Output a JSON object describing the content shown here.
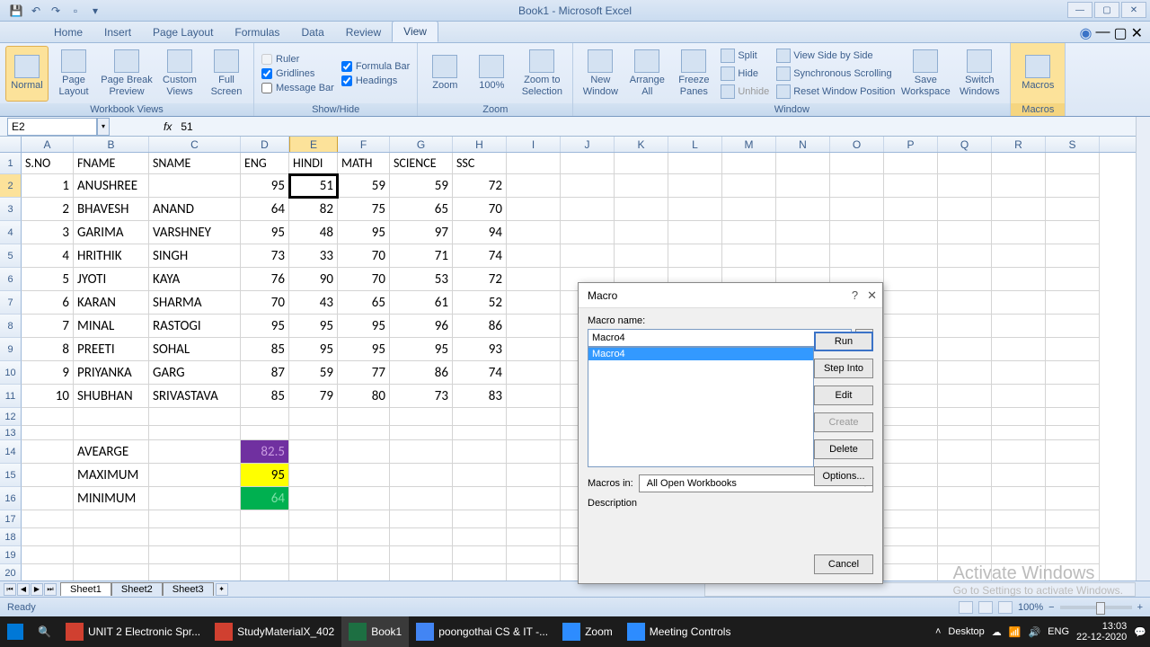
{
  "app": {
    "title": "Book1 - Microsoft Excel",
    "status": "Ready"
  },
  "tabs": {
    "home": "Home",
    "insert": "Insert",
    "page_layout": "Page Layout",
    "formulas": "Formulas",
    "data": "Data",
    "review": "Review",
    "view": "View"
  },
  "ribbon": {
    "workbook_views": {
      "label": "Workbook Views",
      "normal": "Normal",
      "page_layout": "Page Layout",
      "page_break": "Page Break Preview",
      "custom": "Custom Views",
      "full": "Full Screen"
    },
    "show_hide": {
      "label": "Show/Hide",
      "ruler": "Ruler",
      "gridlines": "Gridlines",
      "message_bar": "Message Bar",
      "formula_bar": "Formula Bar",
      "headings": "Headings"
    },
    "zoom": {
      "label": "Zoom",
      "zoom": "Zoom",
      "hundred": "100%",
      "selection": "Zoom to Selection"
    },
    "window": {
      "label": "Window",
      "new": "New Window",
      "arrange": "Arrange All",
      "freeze": "Freeze Panes",
      "split": "Split",
      "hide": "Hide",
      "unhide": "Unhide",
      "side": "View Side by Side",
      "sync": "Synchronous Scrolling",
      "reset": "Reset Window Position",
      "save": "Save Workspace",
      "switch": "Switch Windows"
    },
    "macros": {
      "label": "Macros",
      "macros": "Macros"
    }
  },
  "name_box": "E2",
  "formula_value": "51",
  "columns": [
    "A",
    "B",
    "C",
    "D",
    "E",
    "F",
    "G",
    "H",
    "I",
    "J",
    "K",
    "L",
    "M",
    "N",
    "O",
    "P",
    "Q",
    "R",
    "S"
  ],
  "headers": [
    "S.NO",
    "FNAME",
    "SNAME",
    "ENG",
    "HINDI",
    "MATH",
    "SCIENCE",
    "SSC"
  ],
  "rows": [
    {
      "sno": "1",
      "fname": "ANUSHREE",
      "sname": "",
      "eng": "95",
      "hindi": "51",
      "math": "59",
      "science": "59",
      "ssc": "72"
    },
    {
      "sno": "2",
      "fname": "BHAVESH",
      "sname": "ANAND",
      "eng": "64",
      "hindi": "82",
      "math": "75",
      "science": "65",
      "ssc": "70"
    },
    {
      "sno": "3",
      "fname": "GARIMA",
      "sname": "VARSHNEY",
      "eng": "95",
      "hindi": "48",
      "math": "95",
      "science": "97",
      "ssc": "94"
    },
    {
      "sno": "4",
      "fname": "HRITHIK",
      "sname": "SINGH",
      "eng": "73",
      "hindi": "33",
      "math": "70",
      "science": "71",
      "ssc": "74"
    },
    {
      "sno": "5",
      "fname": "JYOTI",
      "sname": "KAYA",
      "eng": "76",
      "hindi": "90",
      "math": "70",
      "science": "53",
      "ssc": "72"
    },
    {
      "sno": "6",
      "fname": "KARAN",
      "sname": "SHARMA",
      "eng": "70",
      "hindi": "43",
      "math": "65",
      "science": "61",
      "ssc": "52"
    },
    {
      "sno": "7",
      "fname": "MINAL",
      "sname": "RASTOGI",
      "eng": "95",
      "hindi": "95",
      "math": "95",
      "science": "96",
      "ssc": "86"
    },
    {
      "sno": "8",
      "fname": "PREETI",
      "sname": "SOHAL",
      "eng": "85",
      "hindi": "95",
      "math": "95",
      "science": "95",
      "ssc": "93"
    },
    {
      "sno": "9",
      "fname": "PRIYANKA",
      "sname": "GARG",
      "eng": "87",
      "hindi": "59",
      "math": "77",
      "science": "86",
      "ssc": "74"
    },
    {
      "sno": "10",
      "fname": "SHUBHAN",
      "sname": "SRIVASTAVA",
      "eng": "85",
      "hindi": "79",
      "math": "80",
      "science": "73",
      "ssc": "83"
    }
  ],
  "stats": {
    "avg_label": "AVEARGE",
    "avg_val": "82.5",
    "max_label": "MAXIMUM",
    "max_val": "95",
    "min_label": "MINIMUM",
    "min_val": "64"
  },
  "sheets": {
    "s1": "Sheet1",
    "s2": "Sheet2",
    "s3": "Sheet3"
  },
  "macro": {
    "title": "Macro",
    "name_label": "Macro name:",
    "name_value": "Macro4",
    "list_item": "Macro4",
    "macros_in_label": "Macros in:",
    "macros_in_value": "All Open Workbooks",
    "description_label": "Description",
    "run": "Run",
    "step": "Step Into",
    "edit": "Edit",
    "create": "Create",
    "delete": "Delete",
    "options": "Options...",
    "cancel": "Cancel"
  },
  "taskbar": {
    "item1": "UNIT 2 Electronic Spr...",
    "item2": "StudyMaterialX_402",
    "item3": "Book1",
    "item4": "poongothai CS & IT -...",
    "item5": "Zoom",
    "item6": "Meeting Controls",
    "desktop": "Desktop",
    "lang": "ENG",
    "time": "13:03",
    "date": "22-12-2020"
  },
  "watermark": {
    "main": "Activate Windows",
    "sub": "Go to Settings to activate Windows."
  },
  "zoom_pct": "100%"
}
